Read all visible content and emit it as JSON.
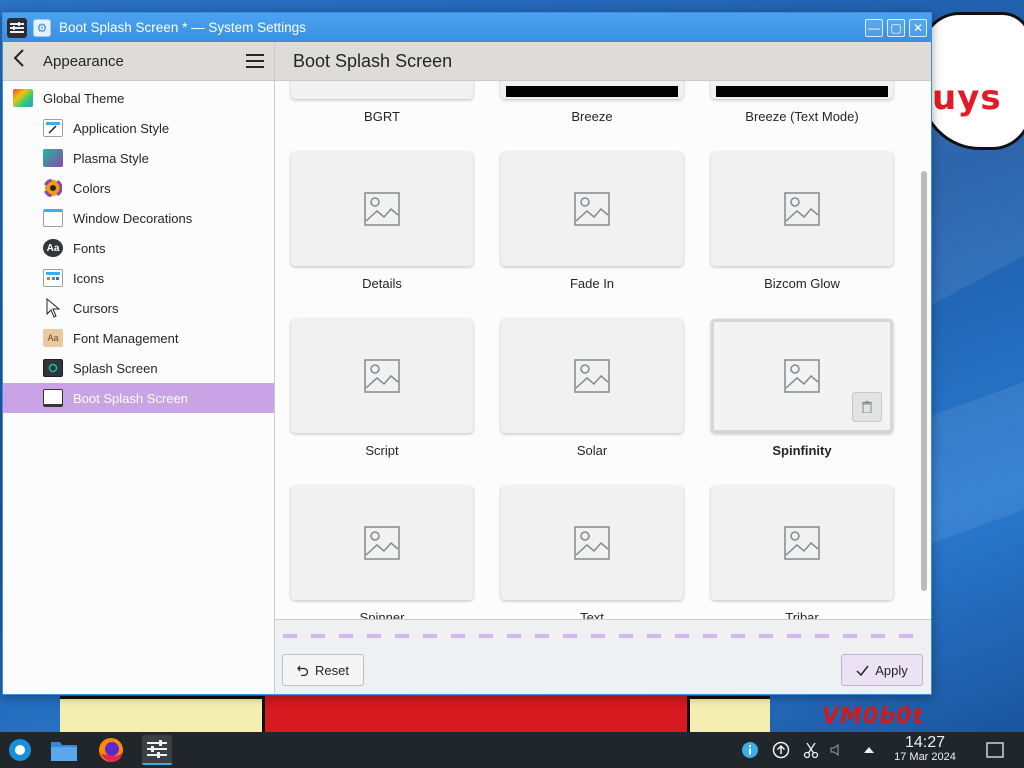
{
  "window": {
    "title": "Boot Splash Screen * — System Settings",
    "min_label": "—",
    "max_label": "▢",
    "close_label": "✕"
  },
  "sidebar": {
    "header": "Appearance",
    "top_item": "Global Theme",
    "items": [
      {
        "label": "Application Style",
        "icon": "application-style-icon"
      },
      {
        "label": "Plasma Style",
        "icon": "plasma-style-icon"
      },
      {
        "label": "Colors",
        "icon": "colors-icon"
      },
      {
        "label": "Window Decorations",
        "icon": "window-decorations-icon"
      },
      {
        "label": "Fonts",
        "icon": "fonts-icon"
      },
      {
        "label": "Icons",
        "icon": "icons-icon"
      },
      {
        "label": "Cursors",
        "icon": "cursors-icon"
      },
      {
        "label": "Font Management",
        "icon": "font-management-icon"
      },
      {
        "label": "Splash Screen",
        "icon": "splash-screen-icon"
      },
      {
        "label": "Boot Splash Screen",
        "icon": "boot-splash-icon",
        "active": true
      }
    ]
  },
  "main": {
    "title": "Boot Splash Screen",
    "themes": [
      {
        "name": "BGRT"
      },
      {
        "name": "Breeze"
      },
      {
        "name": "Breeze (Text Mode)"
      },
      {
        "name": "Details"
      },
      {
        "name": "Fade In"
      },
      {
        "name": "Bizcom Glow"
      },
      {
        "name": "Script"
      },
      {
        "name": "Solar"
      },
      {
        "name": "Spinfinity",
        "selected": true
      },
      {
        "name": "Spinner"
      },
      {
        "name": "Text"
      },
      {
        "name": "Tribar"
      }
    ]
  },
  "footer": {
    "reset_label": "Reset",
    "apply_label": "Apply"
  },
  "desktop": {
    "bubble_text": "uys",
    "vm_logo": "VM0b0t"
  },
  "taskbar": {
    "time": "14:27",
    "date": "17 Mar 2024"
  },
  "colors": {
    "accent": "#3a8fe0",
    "selection": "#c9a3e6",
    "taskbar": "#21262b"
  }
}
